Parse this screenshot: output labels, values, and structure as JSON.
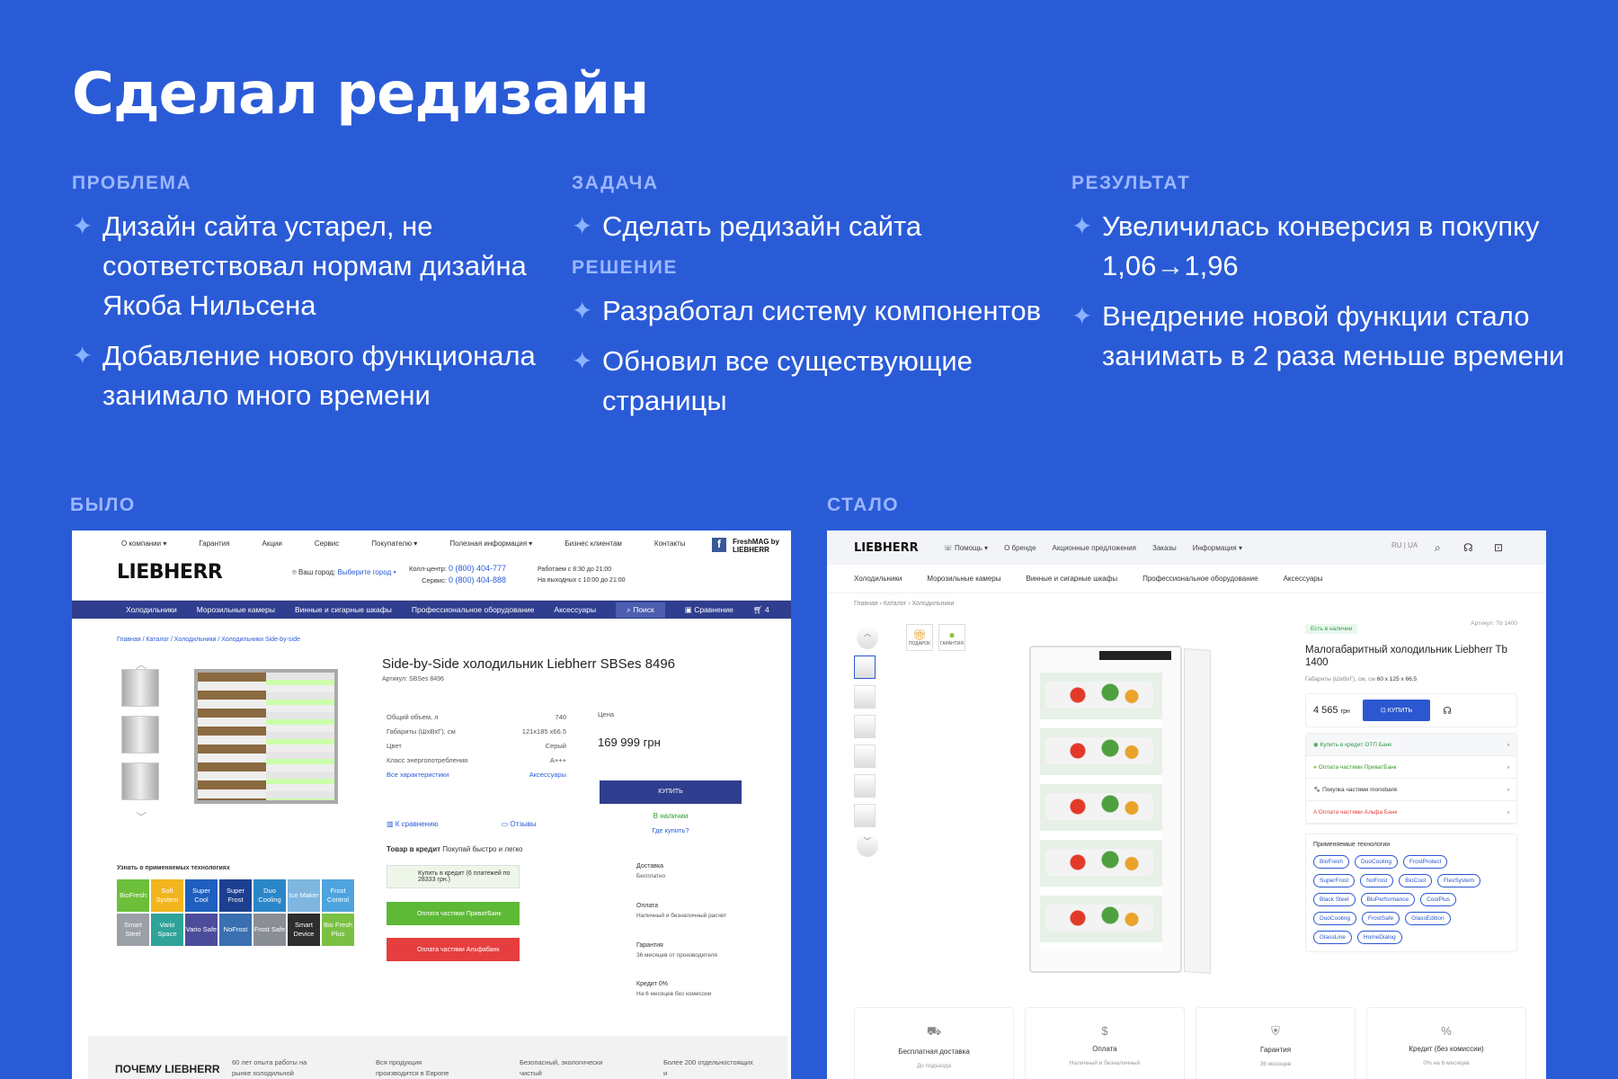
{
  "title": "Сделал редизайн",
  "problem": {
    "label": "ПРОБЛЕМА",
    "items": [
      "Дизайн сайта устарел, не соответствовал нормам дизайна Якоба Нильсена",
      "Добавление нового функционала занимало много времени"
    ]
  },
  "task": {
    "label": "ЗАДАЧА",
    "items": [
      "Сделать редизайн сайта"
    ]
  },
  "solution": {
    "label": "РЕШЕНИЕ",
    "items": [
      "Разработал систему компонентов",
      "Обновил все существующие страницы"
    ]
  },
  "result": {
    "label": "РЕЗУЛЬТАТ",
    "items": [
      "Увеличилась конверсия в покупку 1,06→1,96",
      "Внедрение новой функции стало занимать в 2 раза меньше времени"
    ]
  },
  "before_label": "БЫЛО",
  "after_label": "СТАЛО",
  "old": {
    "topnav": [
      "О компании ▾",
      "Гарантия",
      "Акции",
      "Сервис",
      "Покупателю ▾",
      "Полезная информация ▾",
      "Бизнес клиентам",
      "Контакты"
    ],
    "logo": "LIEBHERR",
    "freshmag": "FreshMAG by LIEBHERR",
    "city_label": "Ваш город:",
    "city_link": "Выберите город ▾",
    "callcenter": "Колл-центр:",
    "phone1": "0 (800) 404-777",
    "service": "Сервис:",
    "phone2": "0 (800) 404-888",
    "hours1": "Работаем с 8:30 до 21:00",
    "hours2": "На выходных с 10:00 до 21:00",
    "menu": [
      "Холодильники",
      "Морозильные камеры",
      "Винные и сигарные шкафы",
      "Профессиональное оборудование",
      "Аксессуары"
    ],
    "search": "Поиск",
    "compare": "Сравнение",
    "cart_count": "4",
    "breadcrumb": "Главная / Каталог / Холодильники / Холодильники Side-by-side",
    "product_title": "Side-by-Side холодильник Liebherr SBSes 8496",
    "article": "Артикул: SBSes 8496",
    "specs": [
      [
        "Общий объем, л",
        "740"
      ],
      [
        "Габариты (ШхВхГ), см",
        "121х185 х66.5"
      ],
      [
        "Цвет",
        "Серый"
      ],
      [
        "Класс энергопотребления",
        "A+++"
      ]
    ],
    "all_specs": "Все характеристики",
    "accessories": "Аксессуары",
    "price_label": "Цена",
    "price": "169 999 грн",
    "buy": "КУПИТЬ",
    "in_stock": "В наличии",
    "where_buy": "Где купить?",
    "to_compare": "К сравнению",
    "reviews": "Отзывы",
    "credit_title": "Товар в кредит",
    "credit_sub": "Покупай быстро и легко",
    "credit_btn1": "Купить в кредит (6 платежей по 28333 грн.)",
    "credit_btn2": "Оплата частями ПриватБанк",
    "credit_btn3": "Оплата частями Альфабанк",
    "side": [
      [
        "Доставка",
        "Бесплатно"
      ],
      [
        "Оплата",
        "Наличный и безналичный расчет"
      ],
      [
        "Гарантия",
        "36 месяцев от производителя"
      ],
      [
        "Кредит 0%",
        "На 6 месяцев без комиссии"
      ]
    ],
    "tech_title": "Узнать о применяемых технологиях",
    "techs": [
      "BioFresh",
      "Soft System",
      "Super Cool",
      "Super Frost",
      "Duo Cooling",
      "Ice Maker",
      "Frost Control",
      "Smart Steel",
      "Vario Space",
      "Vario Safe",
      "NoFrost",
      "Frost Safe",
      "Smart Device",
      "Bio Fresh Plus"
    ],
    "tech_colors": [
      "#6cbf3a",
      "#f2b51d",
      "#1e5fbf",
      "#1d3f8f",
      "#2b86c7",
      "#7fb6e0",
      "#4ea4de",
      "#9aa0a6",
      "#2fa39a",
      "#4c4c9c",
      "#3a6fb0",
      "#8a8f96",
      "#2d2d2d",
      "#7ac143"
    ],
    "why": "ПОЧЕМУ LIEBHERR",
    "why_items": [
      "60 лет опыта работы на рынке холодильной",
      "Вся продукция производится в Европе",
      "Безопасный, экологически чистый",
      "Более 200 отдельностоящих и"
    ]
  },
  "new": {
    "logo": "LIEBHERR",
    "topnav": [
      "Помощь ▾",
      "О бренде",
      "Акционные предложения",
      "Заказы",
      "Информация ▾"
    ],
    "lang": "RU | UA",
    "cats": [
      "Холодильники",
      "Морозильные камеры",
      "Винные и сигарные шкафы",
      "Профессиональное оборудование",
      "Аксессуары"
    ],
    "breadcrumb": "Главная  ›  Каталог  ›  Холодильники",
    "badge1": "ПОДАРОК",
    "badge2": "ГАРАНТИЯ",
    "stock": "Есть в наличии",
    "sku": "Артикул: Tb 1400",
    "product_title": "Малогабаритный холодильник Liebherr Tb 1400",
    "dims_label": "Габариты (ШхВхГ), см",
    "dims": "60 х 125 х 66.5",
    "price": "4 565",
    "currency": "грн",
    "buy": "КУПИТЬ",
    "pay": [
      "Купить в кредит ОТП Банк",
      "Оплата частями ПриватБанк",
      "Покупка частями monobank",
      "Оплата частями Альфа Банк"
    ],
    "tech_title": "Применяемые технологии",
    "tags": [
      "BioFresh",
      "DuoCooling",
      "FrostProtect",
      "SuperFrost",
      "NoFrost",
      "BioCool",
      "FlexSystem",
      "Black Steel",
      "BluPerformance",
      "CoolPlus",
      "DuoCooling",
      "FrostSafe",
      "GlassEdition",
      "GlassLine",
      "HomeDialog"
    ],
    "features": [
      [
        "Бесплатная доставка",
        "До подъезда"
      ],
      [
        "Оплата",
        "Наличный и безналичный"
      ],
      [
        "Гарантия",
        "36 месяцев"
      ],
      [
        "Кредит (без комиссии)",
        "0% на 6 месяцев"
      ]
    ]
  }
}
